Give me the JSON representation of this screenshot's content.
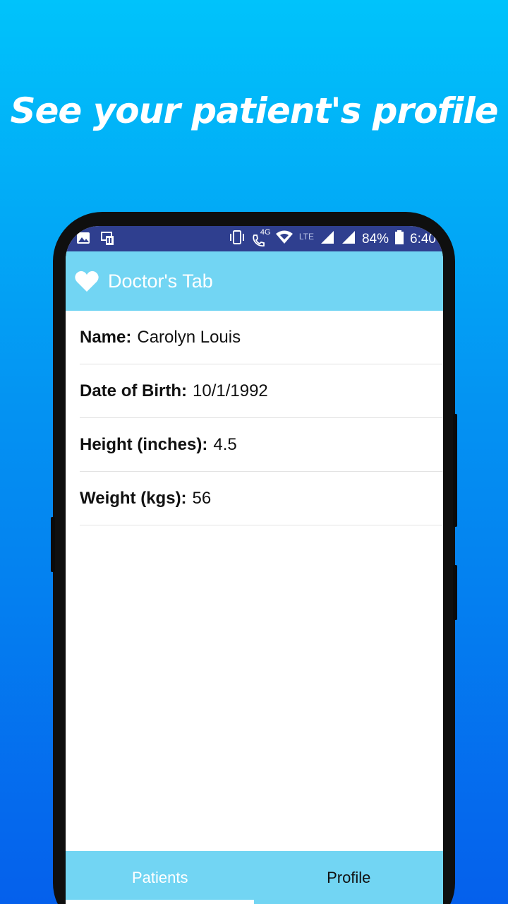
{
  "headline": "See your patient's profile",
  "status_bar": {
    "network_4g": "4G",
    "network_lte": "LTE",
    "battery": "84%",
    "time": "6:40",
    "icons": [
      "gallery-icon",
      "cast-icon",
      "vibrate-icon",
      "wifi-call-icon",
      "wifi-icon",
      "signal-icon",
      "signal-icon",
      "battery-icon"
    ]
  },
  "app_bar": {
    "icon": "heart-icon",
    "title": "Doctor's Tab",
    "accent_color": "#72d5f3"
  },
  "profile": [
    {
      "label": "Name:",
      "value": "Carolyn Louis"
    },
    {
      "label": "Date of Birth:",
      "value": "10/1/1992"
    },
    {
      "label": "Height (inches):",
      "value": "4.5"
    },
    {
      "label": "Weight (kgs):",
      "value": "56"
    }
  ],
  "bottom_nav": {
    "tabs": [
      {
        "label": "Patients",
        "selected": true
      },
      {
        "label": "Profile",
        "selected": false
      }
    ]
  }
}
